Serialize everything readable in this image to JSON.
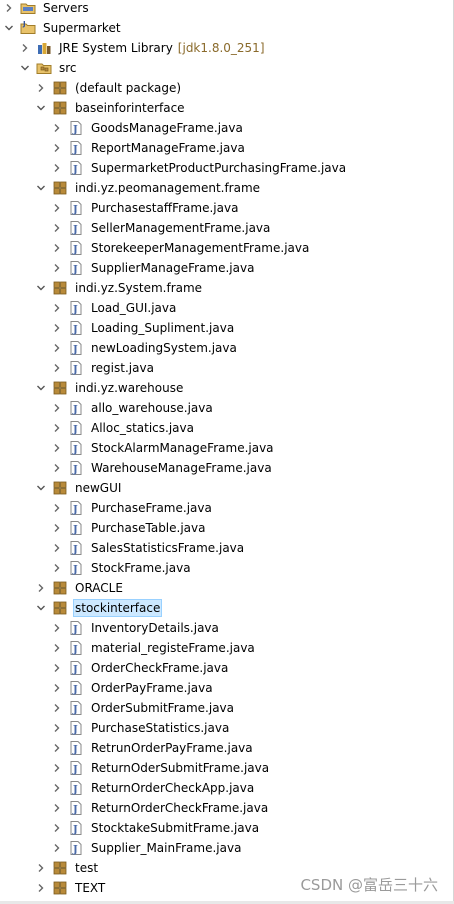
{
  "colors": {
    "selection": "#cce8ff",
    "package_icon": "#b88a3a",
    "java_file_icon": "#4a6aa8",
    "decoration_text": "#8a6a2b"
  },
  "tree": [
    {
      "label": "Servers",
      "level": 0,
      "toggle": "collapsed",
      "icon": "folder-icon"
    },
    {
      "label": "Supermarket",
      "level": 0,
      "toggle": "expanded",
      "icon": "java-project-icon"
    },
    {
      "label": "JRE System Library",
      "decoration": "[jdk1.8.0_251]",
      "level": 1,
      "toggle": "collapsed",
      "icon": "library-icon"
    },
    {
      "label": "src",
      "level": 1,
      "toggle": "expanded",
      "icon": "source-folder-icon"
    },
    {
      "label": "(default package)",
      "level": 2,
      "toggle": "collapsed",
      "icon": "package-icon"
    },
    {
      "label": "baseinforinterface",
      "level": 2,
      "toggle": "expanded",
      "icon": "package-icon"
    },
    {
      "label": "GoodsManageFrame.java",
      "level": 3,
      "toggle": "collapsed",
      "icon": "java-file-icon"
    },
    {
      "label": "ReportManageFrame.java",
      "level": 3,
      "toggle": "collapsed",
      "icon": "java-file-icon"
    },
    {
      "label": "SupermarketProductPurchasingFrame.java",
      "level": 3,
      "toggle": "collapsed",
      "icon": "java-file-icon"
    },
    {
      "label": "indi.yz.peomanagement.frame",
      "level": 2,
      "toggle": "expanded",
      "icon": "package-icon"
    },
    {
      "label": "PurchasestaffFrame.java",
      "level": 3,
      "toggle": "collapsed",
      "icon": "java-file-icon"
    },
    {
      "label": "SellerManagementFrame.java",
      "level": 3,
      "toggle": "collapsed",
      "icon": "java-file-icon"
    },
    {
      "label": "StorekeeperManagementFrame.java",
      "level": 3,
      "toggle": "collapsed",
      "icon": "java-file-icon"
    },
    {
      "label": "SupplierManageFrame.java",
      "level": 3,
      "toggle": "collapsed",
      "icon": "java-file-icon"
    },
    {
      "label": "indi.yz.System.frame",
      "level": 2,
      "toggle": "expanded",
      "icon": "package-icon"
    },
    {
      "label": "Load_GUI.java",
      "level": 3,
      "toggle": "collapsed",
      "icon": "java-file-icon"
    },
    {
      "label": "Loading_Supliment.java",
      "level": 3,
      "toggle": "collapsed",
      "icon": "java-file-icon"
    },
    {
      "label": "newLoadingSystem.java",
      "level": 3,
      "toggle": "collapsed",
      "icon": "java-file-icon"
    },
    {
      "label": "regist.java",
      "level": 3,
      "toggle": "collapsed",
      "icon": "java-file-icon"
    },
    {
      "label": "indi.yz.warehouse",
      "level": 2,
      "toggle": "expanded",
      "icon": "package-icon"
    },
    {
      "label": "allo_warehouse.java",
      "level": 3,
      "toggle": "collapsed",
      "icon": "java-file-icon"
    },
    {
      "label": "Alloc_statics.java",
      "level": 3,
      "toggle": "collapsed",
      "icon": "java-file-icon"
    },
    {
      "label": "StockAlarmManageFrame.java",
      "level": 3,
      "toggle": "collapsed",
      "icon": "java-file-icon"
    },
    {
      "label": "WarehouseManageFrame.java",
      "level": 3,
      "toggle": "collapsed",
      "icon": "java-file-icon"
    },
    {
      "label": "newGUI",
      "level": 2,
      "toggle": "expanded",
      "icon": "package-icon"
    },
    {
      "label": "PurchaseFrame.java",
      "level": 3,
      "toggle": "collapsed",
      "icon": "java-file-icon"
    },
    {
      "label": "PurchaseTable.java",
      "level": 3,
      "toggle": "collapsed",
      "icon": "java-file-icon"
    },
    {
      "label": "SalesStatisticsFrame.java",
      "level": 3,
      "toggle": "collapsed",
      "icon": "java-file-icon"
    },
    {
      "label": "StockFrame.java",
      "level": 3,
      "toggle": "collapsed",
      "icon": "java-file-icon"
    },
    {
      "label": "ORACLE",
      "level": 2,
      "toggle": "collapsed",
      "icon": "package-icon"
    },
    {
      "label": "stockinterface",
      "level": 2,
      "toggle": "expanded",
      "icon": "package-icon",
      "selected": true
    },
    {
      "label": "InventoryDetails.java",
      "level": 3,
      "toggle": "collapsed",
      "icon": "java-file-icon"
    },
    {
      "label": "material_registeFrame.java",
      "level": 3,
      "toggle": "collapsed",
      "icon": "java-file-icon"
    },
    {
      "label": "OrderCheckFrame.java",
      "level": 3,
      "toggle": "collapsed",
      "icon": "java-file-icon"
    },
    {
      "label": "OrderPayFrame.java",
      "level": 3,
      "toggle": "collapsed",
      "icon": "java-file-icon"
    },
    {
      "label": "OrderSubmitFrame.java",
      "level": 3,
      "toggle": "collapsed",
      "icon": "java-file-icon"
    },
    {
      "label": "PurchaseStatistics.java",
      "level": 3,
      "toggle": "collapsed",
      "icon": "java-file-icon"
    },
    {
      "label": "RetrunOrderPayFrame.java",
      "level": 3,
      "toggle": "collapsed",
      "icon": "java-file-icon"
    },
    {
      "label": "ReturnOderSubmitFrame.java",
      "level": 3,
      "toggle": "collapsed",
      "icon": "java-file-icon"
    },
    {
      "label": "ReturnOrderCheckApp.java",
      "level": 3,
      "toggle": "collapsed",
      "icon": "java-file-icon"
    },
    {
      "label": "ReturnOrderCheckFrame.java",
      "level": 3,
      "toggle": "collapsed",
      "icon": "java-file-icon"
    },
    {
      "label": "StocktakeSubmitFrame.java",
      "level": 3,
      "toggle": "collapsed",
      "icon": "java-file-icon"
    },
    {
      "label": "Supplier_MainFrame.java",
      "level": 3,
      "toggle": "collapsed",
      "icon": "java-file-icon"
    },
    {
      "label": "test",
      "level": 2,
      "toggle": "collapsed",
      "icon": "package-icon"
    },
    {
      "label": "TEXT",
      "level": 2,
      "toggle": "collapsed",
      "icon": "package-icon"
    }
  ],
  "watermark": "CSDN @富岳三十六"
}
